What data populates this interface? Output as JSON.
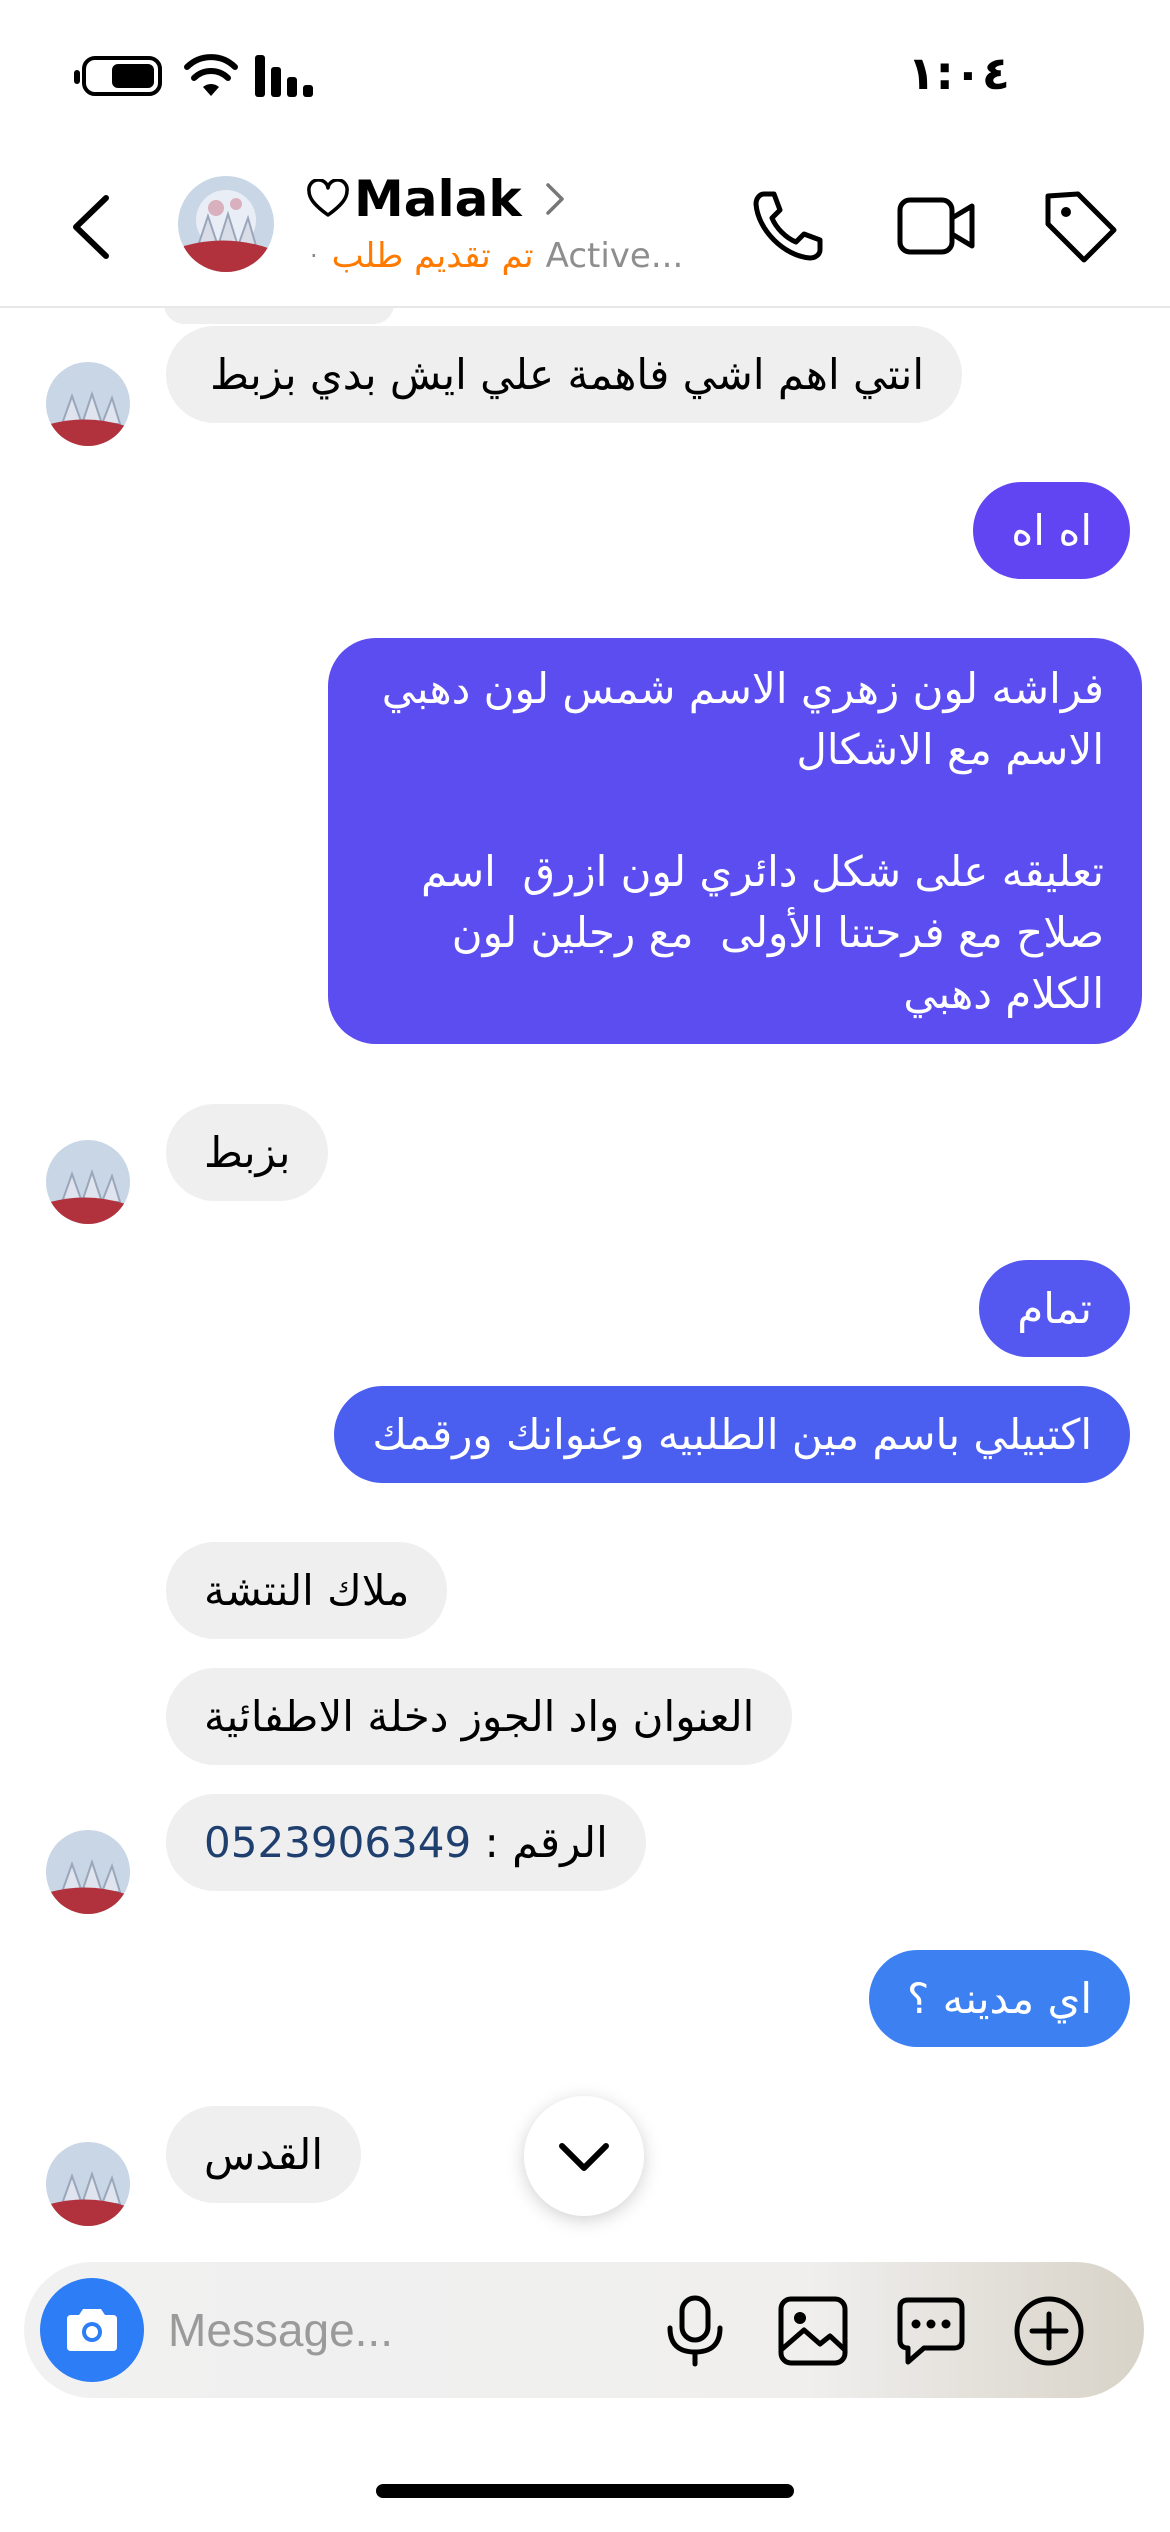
{
  "status_bar": {
    "time": "١:٠٤",
    "battery_level": 0.58
  },
  "header": {
    "contact_name": "Malak",
    "order_status": "تم تقديم طلب",
    "activity": "Active...",
    "separator": "·"
  },
  "messages": [
    {
      "side": "in",
      "text": "انتي اهم اشي فاهمة علي ايش بدي بزبط"
    },
    {
      "side": "out",
      "text": "اه اه"
    },
    {
      "side": "out",
      "text": "فراشه لون زهري الاسم شمس لون دهبي\nالاسم مع الاشكال\n\nتعليقه على شكل دائري لون ازرق  اسم\nصلاح مع فرحتنا الأولى  مع رجلين لون\nالكلام دهبي"
    },
    {
      "side": "in",
      "text": "بزبط"
    },
    {
      "side": "out",
      "text": "تمام"
    },
    {
      "side": "out",
      "text": "اكتبيلي باسم مين الطلبيه وعنوانك ورقمك"
    },
    {
      "side": "in",
      "text": "ملاك النتشة"
    },
    {
      "side": "in",
      "text": "العنوان واد الجوز دخلة الاطفائية"
    },
    {
      "side": "in",
      "text_prefix": "الرقم : ",
      "phone": "0523906349"
    },
    {
      "side": "out",
      "text": "اي مدينه ؟"
    },
    {
      "side": "in",
      "text": "القدس"
    }
  ],
  "composer": {
    "placeholder": "Message..."
  },
  "colors": {
    "out_purple": "#6145f2",
    "out_violet": "#5b4df0",
    "out_blue": "#4a5ef0",
    "out_sky": "#3d80f2",
    "order_orange": "#ff7a00",
    "camera_blue": "#2c7df6",
    "incoming_gray": "#efefef"
  },
  "icons": [
    "back-chevron-icon",
    "heart-icon",
    "chevron-right-icon",
    "phone-icon",
    "video-icon",
    "tag-icon",
    "camera-icon",
    "microphone-icon",
    "gallery-icon",
    "sticker-chat-icon",
    "add-icon",
    "scroll-down-chevron-icon"
  ]
}
